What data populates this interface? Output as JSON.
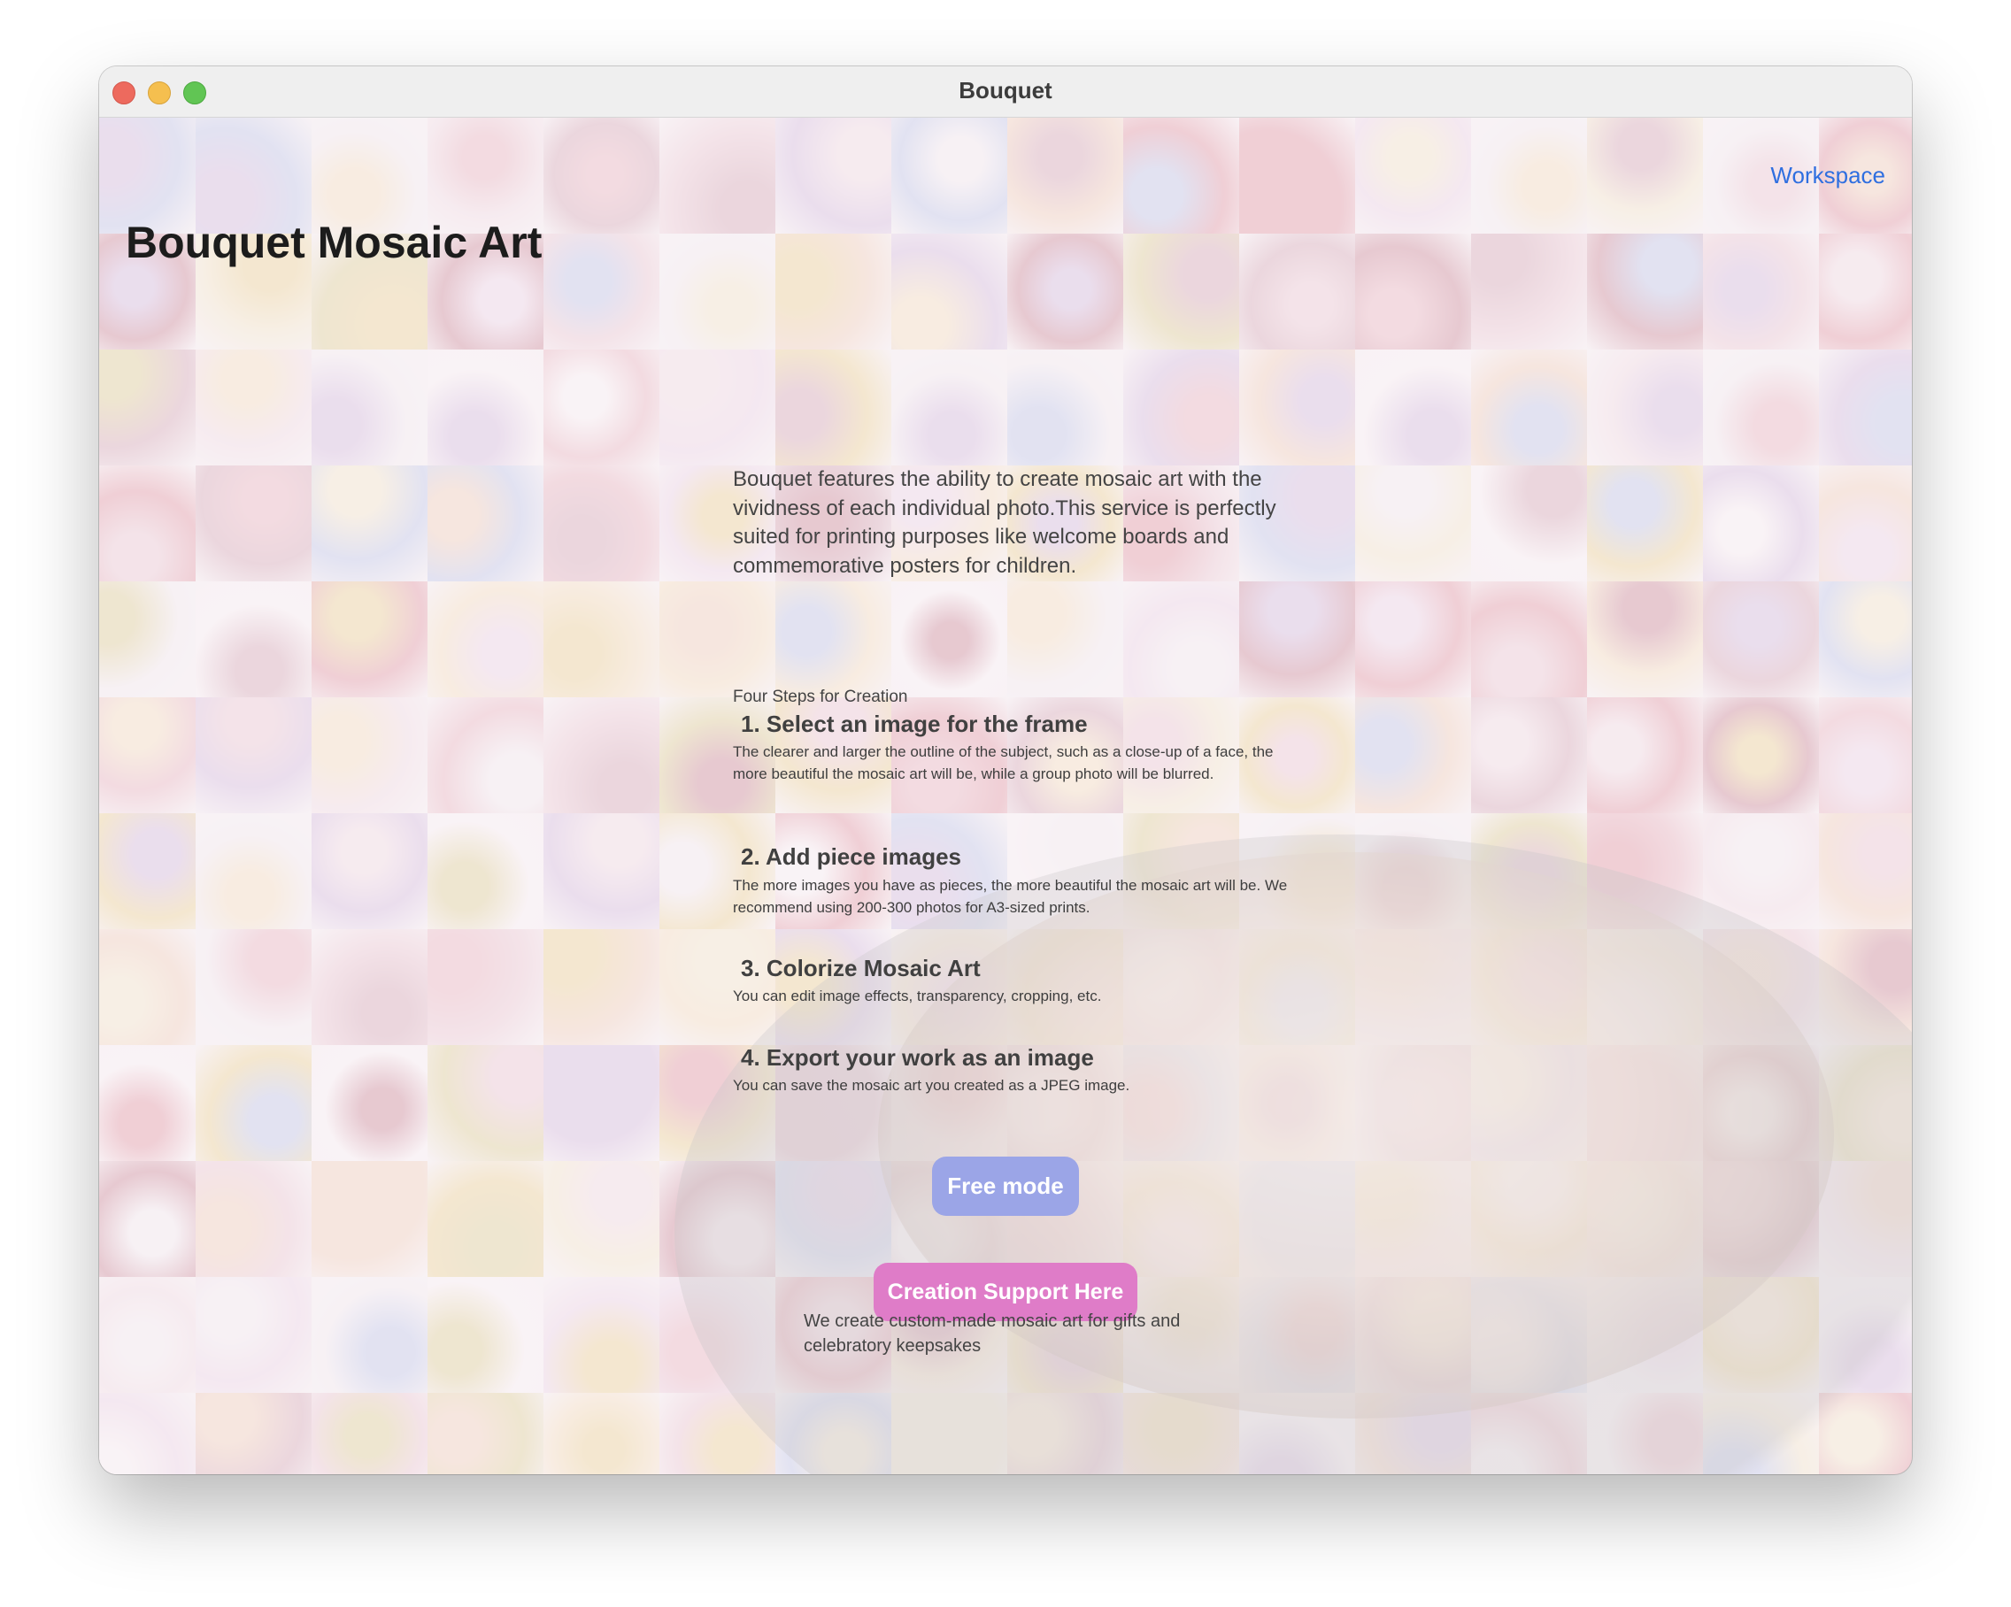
{
  "window": {
    "title": "Bouquet"
  },
  "header": {
    "workspace_link": "Workspace",
    "app_title": "Bouquet Mosaic Art"
  },
  "main": {
    "intro": "Bouquet features the ability to create mosaic art with the vividness of each individual photo.This service is perfectly suited for printing purposes like welcome boards and commemorative posters for children.",
    "steps_label": "Four Steps for Creation",
    "steps": [
      {
        "heading": "1. Select an image for the frame",
        "description": "The clearer and larger the outline of the subject, such as a close-up of a face, the more beautiful the mosaic art will be, while a group photo will be blurred."
      },
      {
        "heading": "2. Add piece images",
        "description": "The more images you have as pieces, the more beautiful the mosaic art will be. We recommend using 200-300 photos for A3-sized prints."
      },
      {
        "heading": "3. Colorize Mosaic Art",
        "description": "You can edit image effects, transparency, cropping, etc."
      },
      {
        "heading": "4. Export your work as an image",
        "description": "You can save the mosaic art you created as a JPEG image."
      }
    ],
    "free_mode_button": "Free mode",
    "support_button": "Creation Support Here",
    "support_description": "We create custom-made mosaic art for gifts and celebratory keepsakes"
  },
  "colors": {
    "accent_link": "#2f6fe0",
    "free_mode_button": "#9ba5e7",
    "support_button": "#df7cc8"
  }
}
